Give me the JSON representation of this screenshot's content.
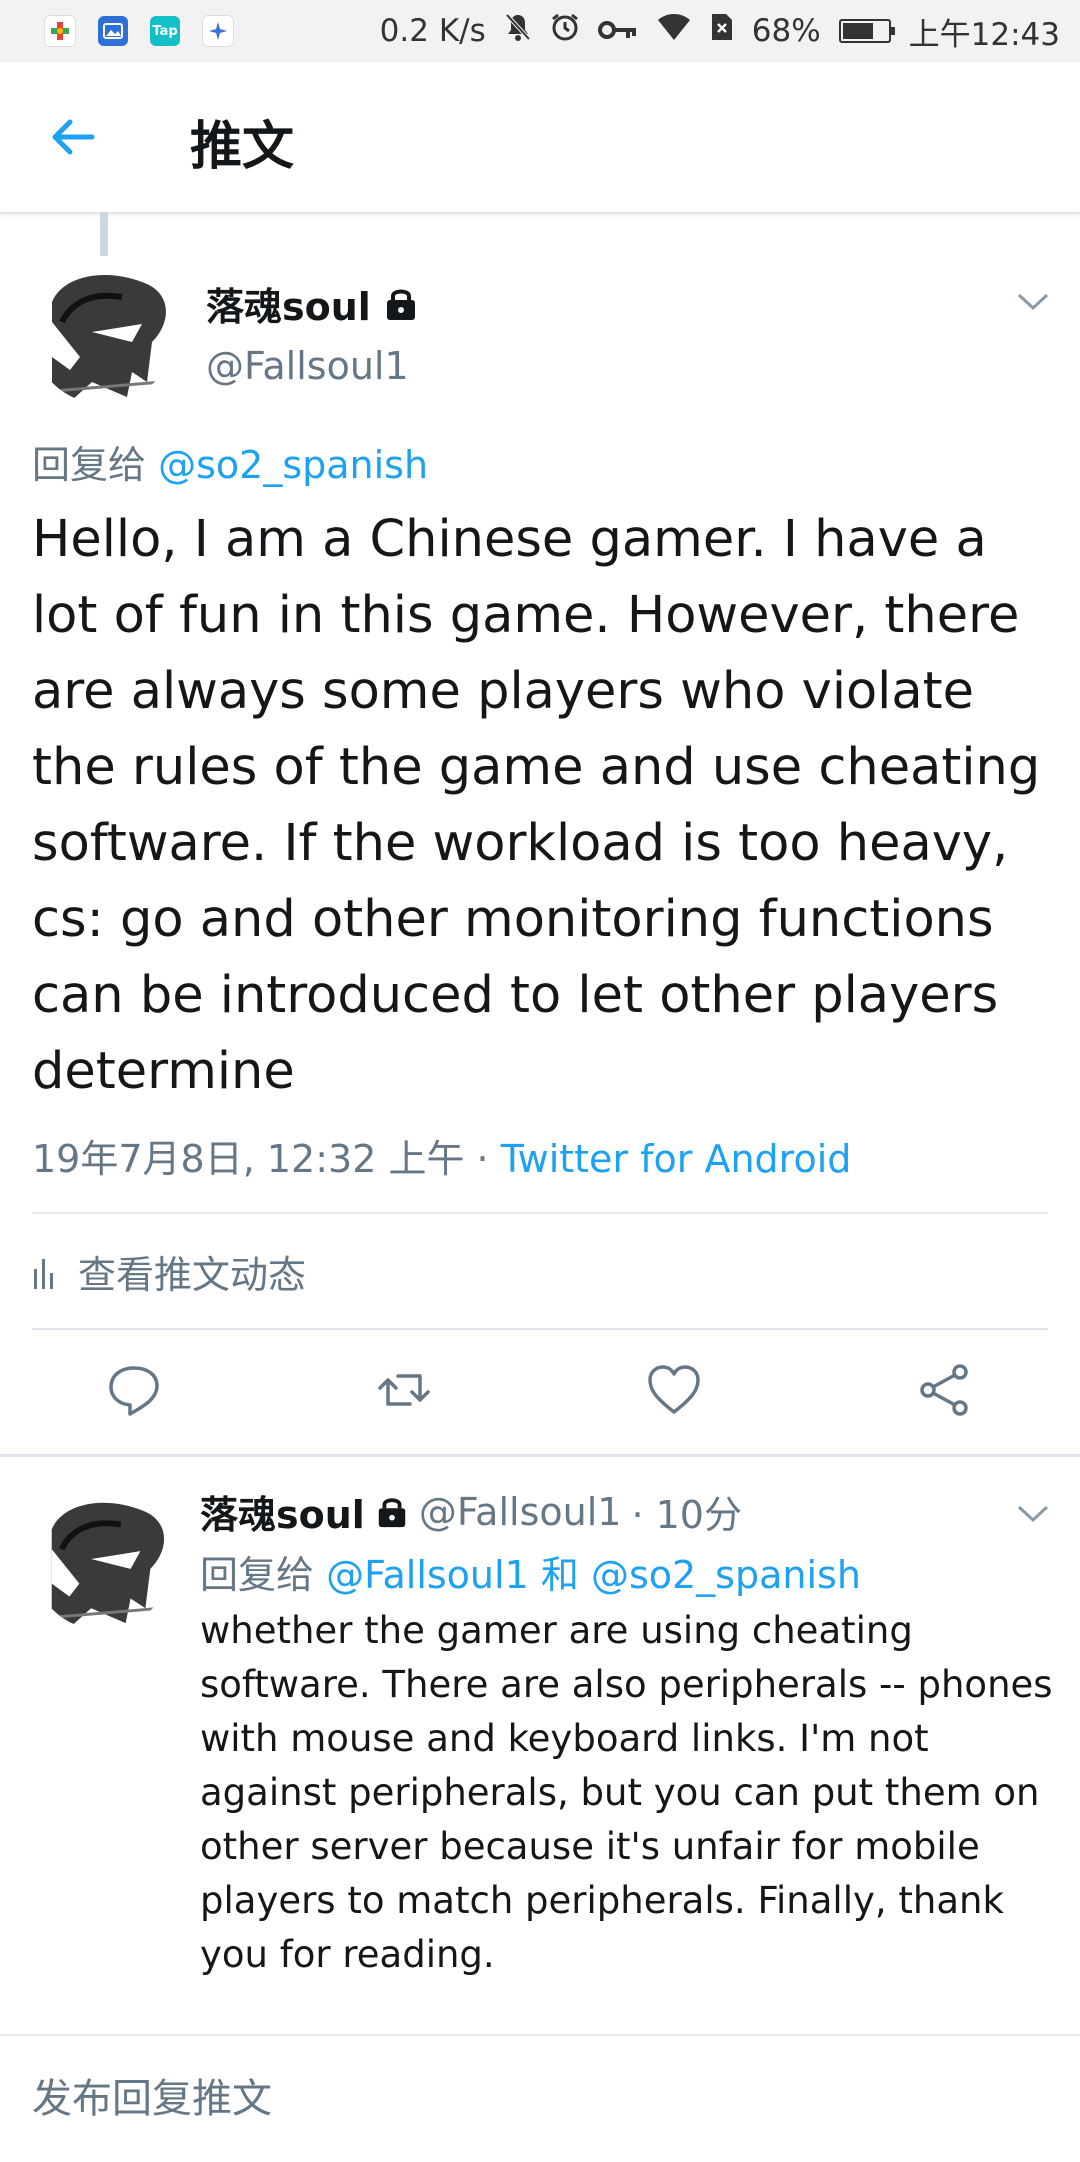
{
  "status_bar": {
    "speed": "0.2 K/s",
    "battery": "68%",
    "battery_level": 0.68,
    "time": "上午12:43",
    "app_icons": [
      "game-app-icon",
      "gallery-app-icon",
      "tap-app-icon",
      "star-app-icon"
    ],
    "tap_label": "Tap"
  },
  "appbar": {
    "title": "推文"
  },
  "tweet": {
    "name": "落魂soul",
    "handle": "@Fallsoul1",
    "replying_prefix": "回复给",
    "replying_to": "@so2_spanish",
    "text": "Hello, I am a Chinese gamer. I have a lot of fun in this game. However, there are always some players who violate the rules of the game and use cheating software. If the workload is too heavy, cs: go and other monitoring functions can be introduced to let other players determine",
    "date": "19年7月8日, 12:32 上午 · ",
    "source": "Twitter for Android",
    "activity": "查看推文动态"
  },
  "reply": {
    "name": "落魂soul",
    "handle": "@Fallsoul1",
    "time": "· 10分",
    "replying_prefix": "回复给",
    "replying_user1": "@Fallsoul1",
    "replying_and": "和",
    "replying_user2": "@so2_spanish",
    "text": "whether the gamer are using cheating software. There are also peripherals -- phones with mouse and keyboard links. I'm not against peripherals, but you can put them on other server because it's unfair for mobile players to match peripherals. Finally, thank you for reading."
  },
  "compose": {
    "placeholder": "发布回复推文"
  },
  "colors": {
    "accent": "#1da1f2",
    "secondary_text": "#657786",
    "divider": "#e1e8ed"
  }
}
